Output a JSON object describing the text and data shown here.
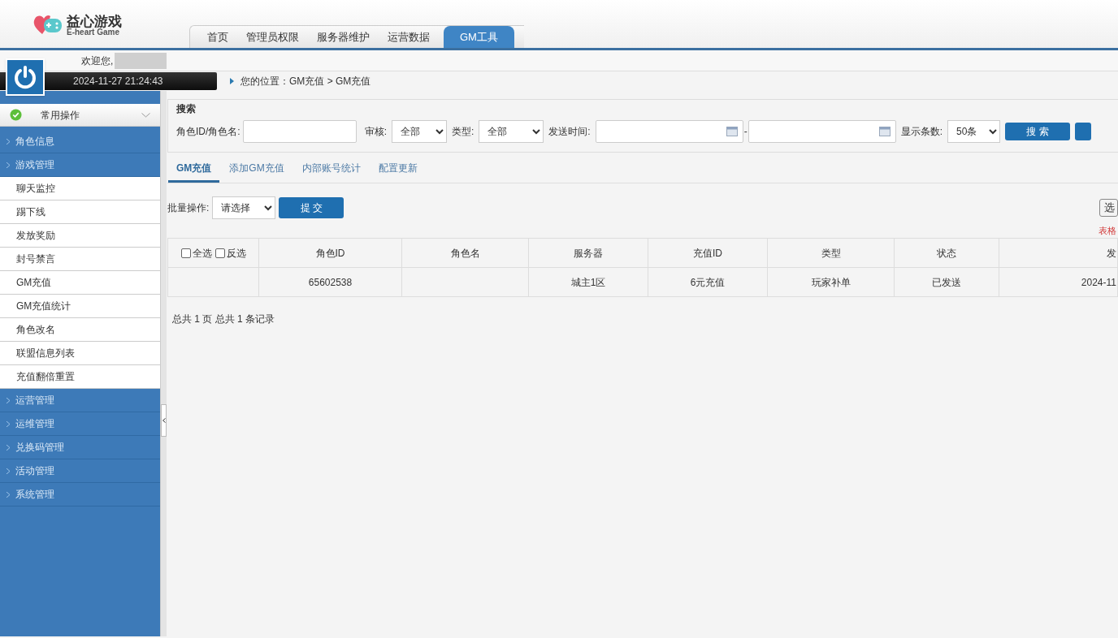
{
  "logo": {
    "title": "益心游戏",
    "subtitle": "E-heart Game"
  },
  "nav_tabs": [
    {
      "label": "首页",
      "selected": false
    },
    {
      "label": "管理员权限",
      "selected": false
    },
    {
      "label": "服务器维护",
      "selected": false
    },
    {
      "label": "运营数据",
      "selected": false
    },
    {
      "label": "GM工具",
      "selected": true
    }
  ],
  "user": {
    "welcome": "欢迎您,",
    "datetime": "2024-11-27 21:24:43"
  },
  "breadcrumb": "您的位置：GM充值 > GM充值",
  "sidebar": {
    "header": "常用操作",
    "groups": [
      {
        "label": "角色信息"
      },
      {
        "label": "游戏管理",
        "children": [
          {
            "label": "聊天监控"
          },
          {
            "label": "踢下线"
          },
          {
            "label": "发放奖励"
          },
          {
            "label": "封号禁言"
          },
          {
            "label": "GM充值"
          },
          {
            "label": "GM充值统计"
          },
          {
            "label": "角色改名"
          },
          {
            "label": "联盟信息列表"
          },
          {
            "label": "充值翻倍重置"
          }
        ]
      },
      {
        "label": "运营管理"
      },
      {
        "label": "运维管理"
      },
      {
        "label": "兑换码管理"
      },
      {
        "label": "活动管理"
      },
      {
        "label": "系统管理"
      }
    ]
  },
  "search": {
    "title": "搜索",
    "role_label": "角色ID/角色名:",
    "review_label": "审核:",
    "review_value": "全部",
    "type_label": "类型:",
    "type_value": "全部",
    "time_label": "发送时间:",
    "time_separator": "-",
    "count_label": "显示条数:",
    "count_value": "50条",
    "search_button": "搜 索"
  },
  "content_tabs": [
    {
      "label": "GM充值",
      "selected": true
    },
    {
      "label": "添加GM充值",
      "selected": false
    },
    {
      "label": "内部账号统计",
      "selected": false
    },
    {
      "label": "配置更新",
      "selected": false
    }
  ],
  "batch": {
    "label": "批量操作:",
    "value": "请选择",
    "submit": "提 交",
    "right_button": "选",
    "note": "表格"
  },
  "table": {
    "select_all": "全选",
    "select_all_checked": false,
    "invert": "反选",
    "invert_checked": false,
    "columns": [
      "角色ID",
      "角色名",
      "服务器",
      "充值ID",
      "类型",
      "状态",
      "发"
    ],
    "rows": [
      [
        "65602538",
        "",
        "城主1区",
        "6元充值",
        "玩家补单",
        "已发送",
        "2024-11"
      ]
    ]
  },
  "pager": "总共 1 页 总共 1 条记录"
}
